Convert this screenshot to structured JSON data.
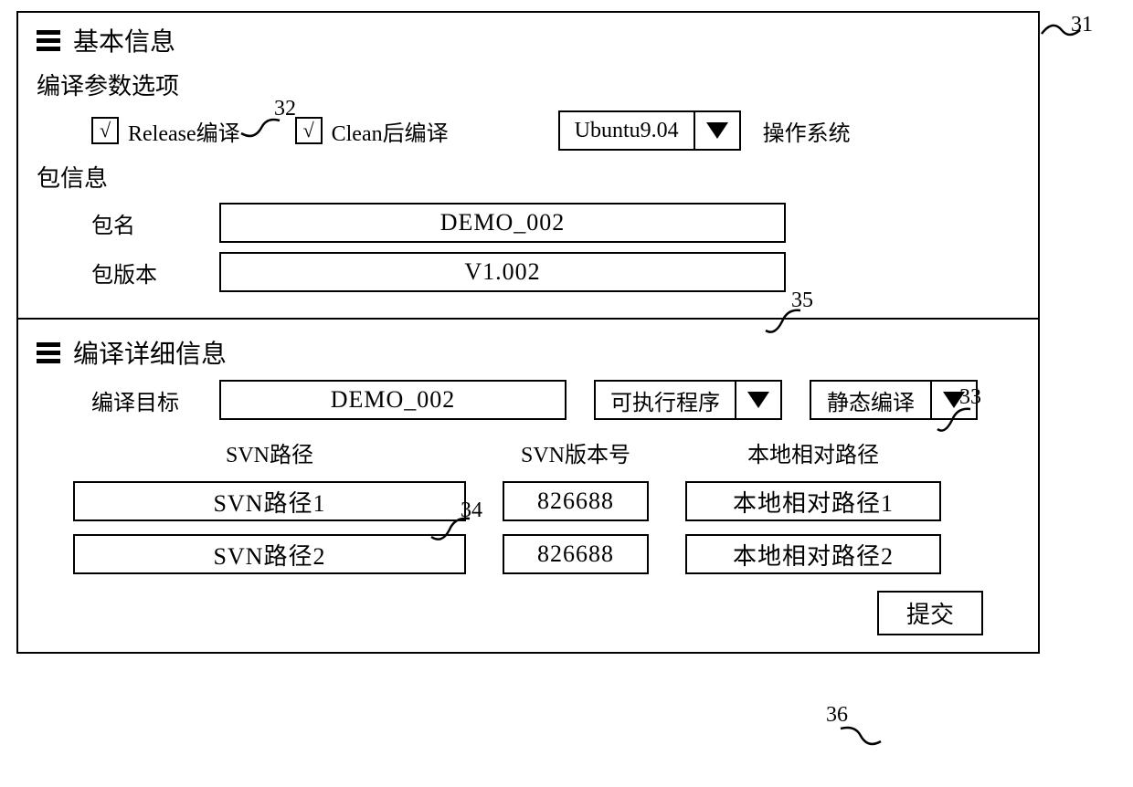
{
  "basic": {
    "title": "基本信息",
    "compile_options_title": "编译参数选项",
    "release_label": "Release编译",
    "release_checked": "√",
    "clean_label": "Clean后编译",
    "clean_checked": "√",
    "os_value": "Ubuntu9.04",
    "os_label": "操作系统",
    "package_title": "包信息",
    "package_name_label": "包名",
    "package_name_value": "DEMO_002",
    "package_version_label": "包版本",
    "package_version_value": "V1.002"
  },
  "detail": {
    "title": "编译详细信息",
    "target_label": "编译目标",
    "target_value": "DEMO_002",
    "type_value": "可执行程序",
    "link_value": "静态编译",
    "svn_path_header": "SVN路径",
    "svn_ver_header": "SVN版本号",
    "local_path_header": "本地相对路径",
    "rows": [
      {
        "path": "SVN路径1",
        "ver": "826688",
        "local": "本地相对路径1"
      },
      {
        "path": "SVN路径2",
        "ver": "826688",
        "local": "本地相对路径2"
      }
    ],
    "submit_label": "提交"
  },
  "callouts": {
    "c31": "31",
    "c32": "32",
    "c33": "33",
    "c34": "34",
    "c35": "35",
    "c36": "36"
  }
}
